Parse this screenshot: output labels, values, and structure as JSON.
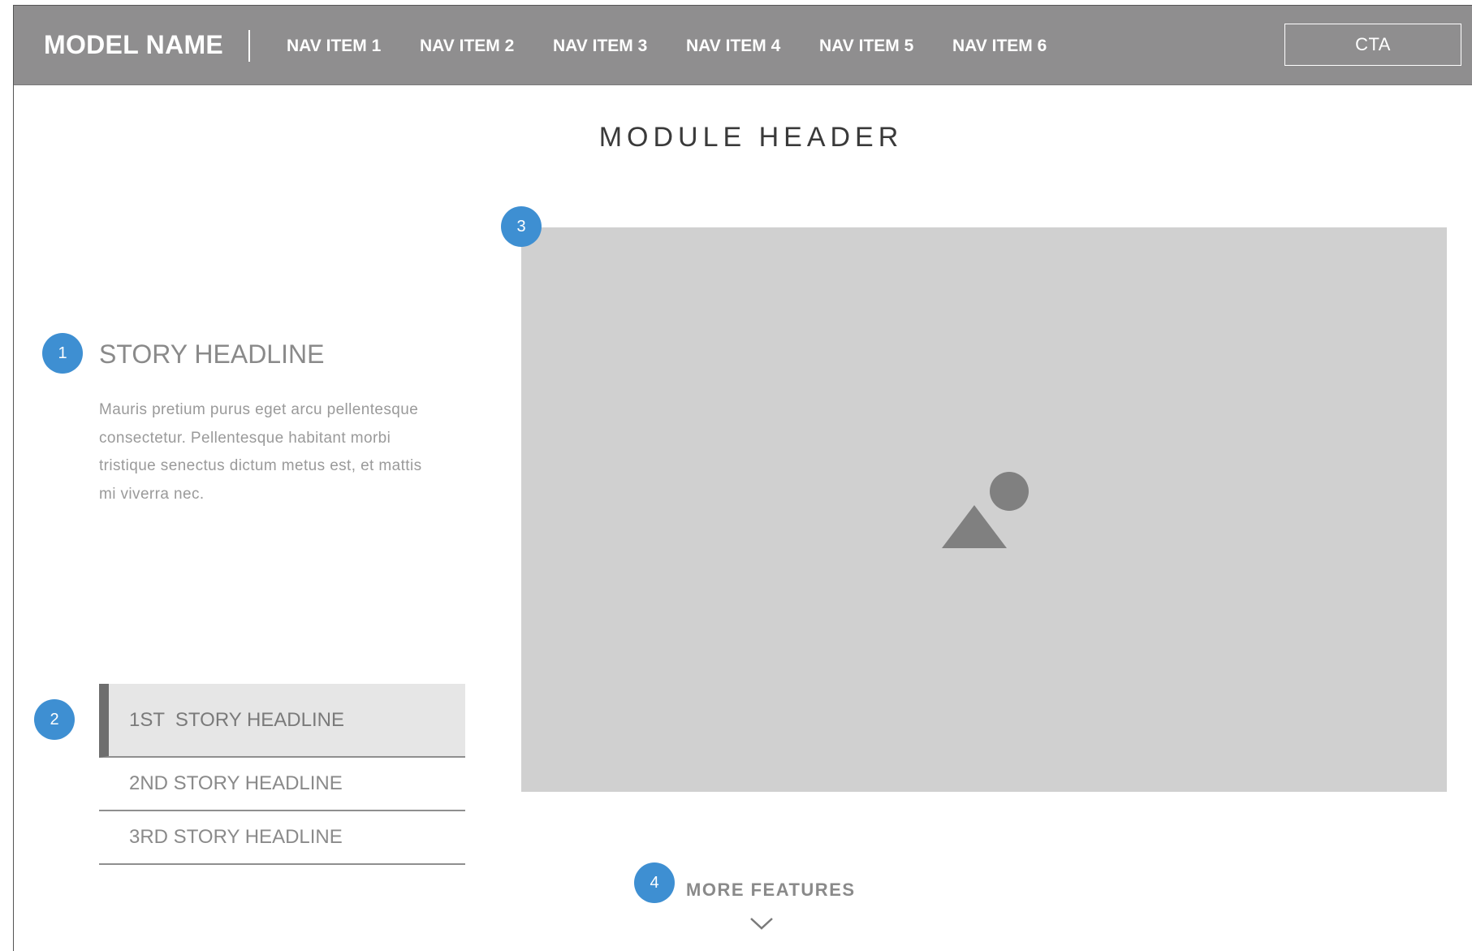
{
  "header": {
    "brand": "MODEL NAME",
    "nav_items": [
      {
        "label": "NAV ITEM 1"
      },
      {
        "label": "NAV ITEM 2"
      },
      {
        "label": "NAV ITEM 3"
      },
      {
        "label": "NAV ITEM 4"
      },
      {
        "label": "NAV ITEM 5"
      },
      {
        "label": "NAV ITEM 6"
      }
    ],
    "cta_label": "CTA"
  },
  "module": {
    "header": "MODULE HEADER"
  },
  "markers": {
    "m1": "1",
    "m2": "2",
    "m3": "3",
    "m4": "4"
  },
  "story": {
    "headline": "STORY HEADLINE",
    "body": "Mauris pretium purus eget arcu pellentesque consectetur. Pellentesque habitant morbi tristique senectus dictum metus est, et mattis mi viverra nec."
  },
  "story_list": [
    {
      "label": "1ST  STORY HEADLINE",
      "active": true
    },
    {
      "label": "2ND STORY HEADLINE",
      "active": false
    },
    {
      "label": "3RD STORY HEADLINE",
      "active": false
    }
  ],
  "media": {
    "icon": "image-placeholder-icon"
  },
  "footer": {
    "more_features": "MORE FEATURES",
    "chevron_icon": "chevron-down-icon"
  },
  "colors": {
    "nav_background": "#8f8e8f",
    "marker": "#3e8fd2",
    "media_placeholder": "#d0d0d0",
    "active_item_background": "#e6e6e6"
  }
}
